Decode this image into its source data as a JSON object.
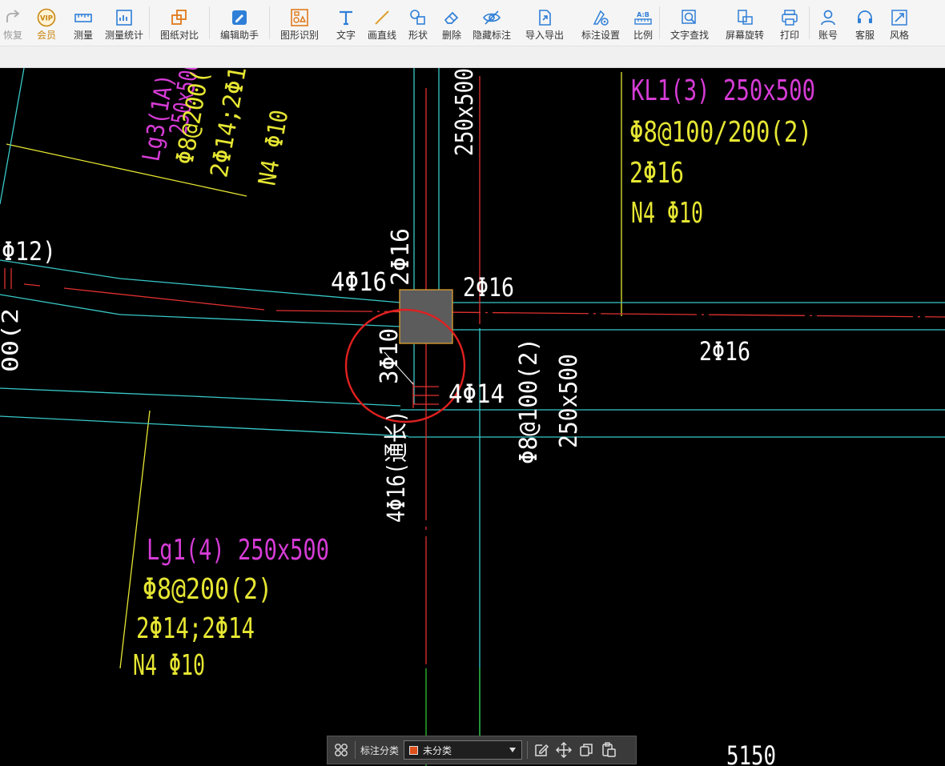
{
  "toolbar": {
    "items": [
      {
        "key": "restore",
        "label": "恢复",
        "icon": "redo-icon"
      },
      {
        "key": "vip",
        "label": "会员",
        "icon": "vip-badge-icon",
        "badge": "VIP"
      },
      {
        "key": "measure",
        "label": "测量",
        "icon": "ruler-icon"
      },
      {
        "key": "measure_stats",
        "label": "测量统计",
        "icon": "measure-stats-icon"
      },
      {
        "key": "compare",
        "label": "图纸对比",
        "icon": "compare-icon"
      },
      {
        "key": "edit_assistant",
        "label": "编辑助手",
        "icon": "edit-assistant-icon"
      },
      {
        "key": "shape_recognize",
        "label": "图形识别",
        "icon": "shape-recognize-icon"
      },
      {
        "key": "text",
        "label": "文字",
        "icon": "text-icon"
      },
      {
        "key": "draw_line",
        "label": "画直线",
        "icon": "line-icon"
      },
      {
        "key": "shape",
        "label": "形状",
        "icon": "shapes-icon"
      },
      {
        "key": "delete",
        "label": "删除",
        "icon": "eraser-icon"
      },
      {
        "key": "hide_marks",
        "label": "隐藏标注",
        "icon": "eye-hidden-icon"
      },
      {
        "key": "import_export",
        "label": "导入导出",
        "icon": "import-export-icon"
      },
      {
        "key": "mark_settings",
        "label": "标注设置",
        "icon": "mark-settings-icon"
      },
      {
        "key": "scale",
        "label": "比例",
        "icon": "scale-icon",
        "badge": "A:B"
      },
      {
        "key": "find_text",
        "label": "文字查找",
        "icon": "find-text-icon"
      },
      {
        "key": "rotate",
        "label": "屏幕旋转",
        "icon": "rotate-screen-icon"
      },
      {
        "key": "print",
        "label": "打印",
        "icon": "printer-icon"
      },
      {
        "key": "account",
        "label": "账号",
        "icon": "user-icon"
      },
      {
        "key": "support",
        "label": "客服",
        "icon": "headset-icon"
      },
      {
        "key": "style",
        "label": "风格",
        "icon": "style-icon"
      }
    ]
  },
  "drawing": {
    "labels": {
      "lg3_name": "Lg3(1A)",
      "lg3_top": "250x500",
      "lg3_stirrup": "Φ8@200(",
      "lg3_bars": "2Φ14;2Φ1",
      "lg3_n": "N4 Φ10",
      "col_top": "250x500",
      "kl1_name": "KL1(3) 250x500",
      "kl1_stirrup": "Φ8@100/200(2)",
      "kl1_bars": "2Φ16",
      "kl1_n": "N4 Φ10",
      "left_edge": "Φ12)",
      "left_edge_vert": "00(2",
      "bars_4_16": "4Φ16",
      "bars_2_16_vert": "2Φ16",
      "bars_2_16_right": "2Φ16",
      "bars_2_16_mid": "2Φ16",
      "bars_3_10": "3Φ10",
      "bars_4_14": "4Φ14",
      "kl_vert_stirrup": "Φ8@100(2)",
      "kl_vert_size": "250x500",
      "bars_4_16_through": "4Φ16(通长)",
      "lg1_name": "Lg1(4) 250x500",
      "lg1_stirrup": "Φ8@200(2)",
      "lg1_bars": "2Φ14;2Φ14",
      "lg1_n": "N4 Φ10",
      "dimension": "5150"
    },
    "colors": {
      "magenta": "#d63cd6",
      "yellow": "#e6e633",
      "white": "#ffffff",
      "cyan": "#38c8c8",
      "red": "#e03030",
      "green": "#30c030",
      "column_fill": "#5c5c5c",
      "column_border": "#e0a030",
      "highlight_circle": "#e02020"
    }
  },
  "bottom_bar": {
    "label": "标注分类",
    "category_value": "未分类",
    "category_color": "#e0501a"
  }
}
